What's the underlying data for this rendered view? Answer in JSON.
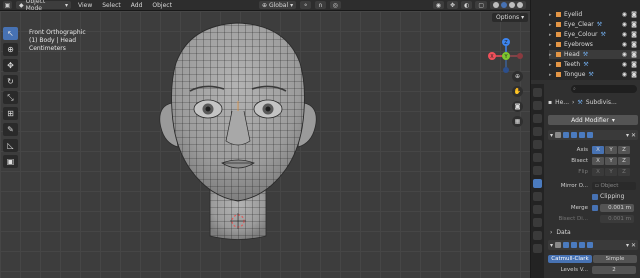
{
  "header": {
    "mode": "Object Mode",
    "menu": [
      "View",
      "Select",
      "Add",
      "Object"
    ],
    "transform_orientation": "Global",
    "options_label": "Options"
  },
  "viewport": {
    "view_name": "Front Orthographic",
    "object_info": "(1) Body | Head",
    "units": "Centimeters",
    "axis_labels": {
      "x": "X",
      "y": "Y",
      "z": "Z"
    }
  },
  "outliner": {
    "items": [
      {
        "label": "Eyelid",
        "selected": false
      },
      {
        "label": "Eye_Clear",
        "selected": false
      },
      {
        "label": "Eye_Colour",
        "selected": false
      },
      {
        "label": "Eyebrows",
        "selected": false
      },
      {
        "label": "Head",
        "selected": true
      },
      {
        "label": "Teeth",
        "selected": false
      },
      {
        "label": "Tongue",
        "selected": false
      }
    ]
  },
  "properties": {
    "search_placeholder": "",
    "object_name": "He...",
    "modifier_name": "Subdivis...",
    "add_modifier": "Add Modifier",
    "mirror": {
      "axis_label": "Axis",
      "bisect_label": "Bisect",
      "flip_label": "Flip",
      "axes": [
        "X",
        "Y",
        "Z"
      ],
      "mirror_object_label": "Mirror O...",
      "mirror_object_value": "Object",
      "clipping_label": "Clipping",
      "merge_label": "Merge",
      "merge_value": "0.001 m",
      "bisect_distance_label": "Bisect Di...",
      "bisect_distance_value": "0.001 m",
      "data_label": "Data"
    },
    "subdivision": {
      "catmull_label": "Catmull-Clark",
      "simple_label": "Simple",
      "levels_label": "Levels V...",
      "levels_value": "2"
    }
  },
  "colors": {
    "accent": "#4772b3",
    "x_axis": "#f0505a",
    "y_axis": "#7ec82e",
    "z_axis": "#3d85f0",
    "object_orange": "#e39545"
  }
}
